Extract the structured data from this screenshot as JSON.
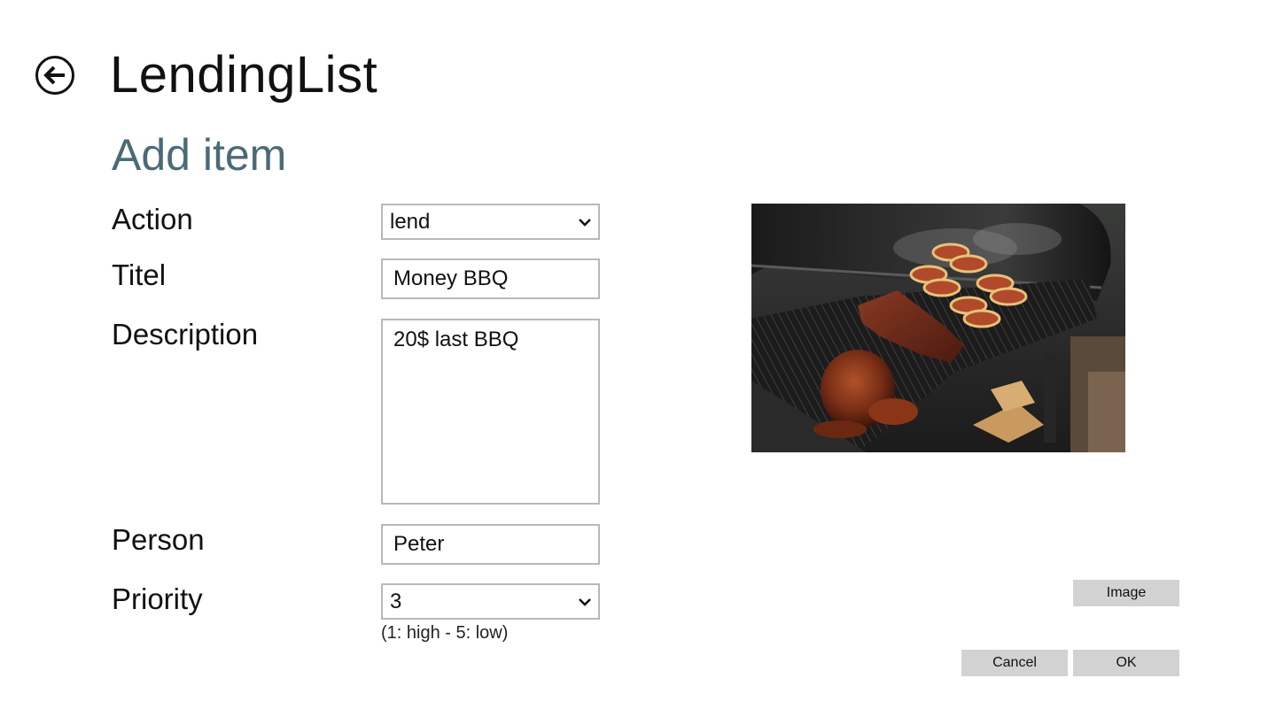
{
  "header": {
    "app_title": "LendingList",
    "page_title": "Add item"
  },
  "form": {
    "action": {
      "label": "Action",
      "value": "lend"
    },
    "title": {
      "label": "Titel",
      "value": "Money BBQ"
    },
    "description": {
      "label": "Description",
      "value": "20$ last BBQ"
    },
    "person": {
      "label": "Person",
      "value": "Peter"
    },
    "priority": {
      "label": "Priority",
      "value": "3",
      "hint": "(1: high - 5: low)"
    }
  },
  "buttons": {
    "image": "Image",
    "cancel": "Cancel",
    "ok": "OK"
  },
  "icons": {
    "back": "back-arrow-icon",
    "dropdown": "chevron-down-icon"
  },
  "colors": {
    "page_title": "#4b6a78",
    "button_bg": "#d2d2d2",
    "field_border": "#b8b8b8"
  }
}
